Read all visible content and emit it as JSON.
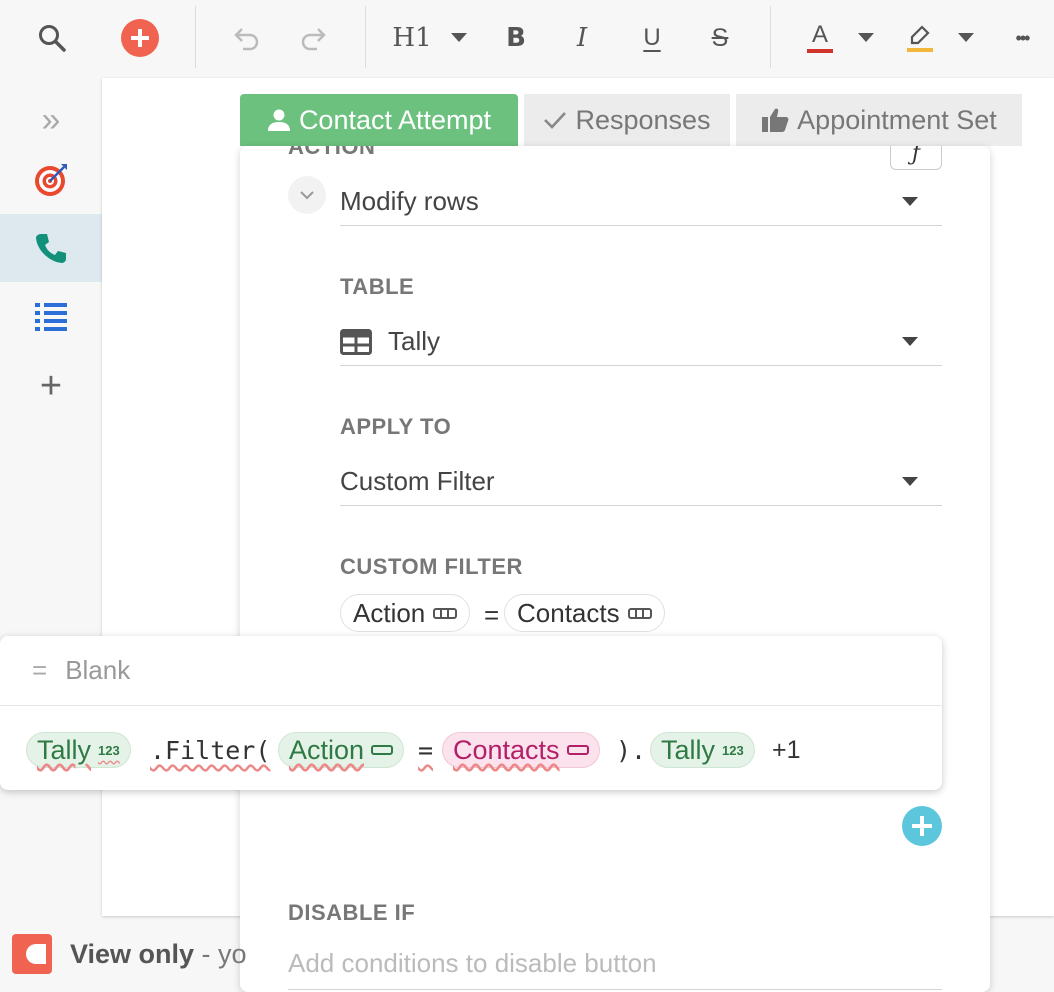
{
  "toolbar": {
    "heading_label": "H1",
    "bold_label": "B",
    "italic_label": "I",
    "underline_label": "U",
    "strike_label": "S",
    "text_color_label": "A",
    "more_label": "•••",
    "icons": [
      "search-icon",
      "add-circle-icon",
      "undo-icon",
      "redo-icon",
      "chevron-down-icon",
      "highlighter-icon"
    ]
  },
  "sidebar": {
    "expand_label": "»",
    "add_label": "+",
    "items": [
      "target-icon",
      "phone-icon",
      "list-icon"
    ]
  },
  "tabs": [
    {
      "label": "Contact Attempt",
      "icon": "person-icon",
      "active": true
    },
    {
      "label": "Responses",
      "icon": "check-icon",
      "active": false
    },
    {
      "label": "Appointment Set",
      "icon": "thumbs-up-icon",
      "active": false
    }
  ],
  "panel": {
    "action_label": "ACTION",
    "fx_label": "ƒ",
    "action_value": "Modify rows",
    "table_label": "TABLE",
    "table_value": "Tally",
    "apply_to_label": "APPLY TO",
    "apply_to_value": "Custom Filter",
    "custom_filter_label": "CUSTOM FILTER",
    "filter_left": "Action",
    "filter_op": "=",
    "filter_right": "Contacts",
    "disable_if_label": "DISABLE IF",
    "disable_if_placeholder": "Add conditions to disable button"
  },
  "formula": {
    "prefix": "=",
    "name": "Blank",
    "tok1": "Tally",
    "tok1_badge": "123",
    "filter_call": ".Filter(",
    "tok2": "Action",
    "eq": "=",
    "tok3": "Contacts",
    "close": ").",
    "tok4": "Tally",
    "tok4_badge": "123",
    "suffix": "+1"
  },
  "footer": {
    "view_only": "View only",
    "rest": " - yo"
  },
  "colors": {
    "accent_green": "#6cc17f",
    "logo": "#f06350",
    "add_button": "#f06350",
    "plus_circle": "#5bc6dc",
    "text_color_bar": "#d0342c",
    "highlight_bar": "#f2b63c"
  }
}
